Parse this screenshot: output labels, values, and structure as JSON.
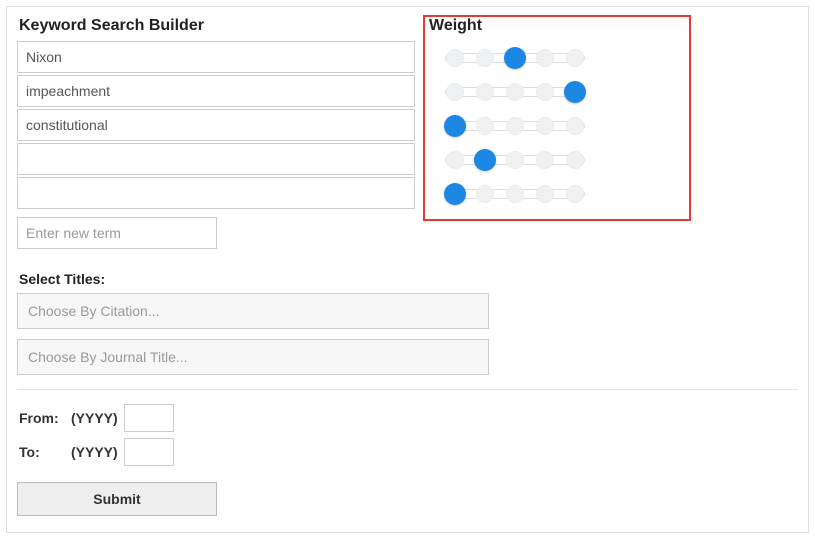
{
  "headers": {
    "builder": "Keyword Search Builder",
    "weight": "Weight"
  },
  "terms": [
    {
      "value": "Nixon",
      "weight_index": 2
    },
    {
      "value": "impeachment",
      "weight_index": 4
    },
    {
      "value": "constitutional",
      "weight_index": 0
    },
    {
      "value": "",
      "weight_index": 1
    },
    {
      "value": "",
      "weight_index": 0
    }
  ],
  "slider": {
    "steps": 5
  },
  "new_term_placeholder": "Enter new term",
  "titles": {
    "label": "Select Titles:",
    "citation_placeholder": "Choose By Citation...",
    "journal_placeholder": "Choose By Journal Title..."
  },
  "date": {
    "from_label": "From:",
    "to_label": "To:",
    "hint": "(YYYY)",
    "from_value": "",
    "to_value": ""
  },
  "submit_label": "Submit"
}
